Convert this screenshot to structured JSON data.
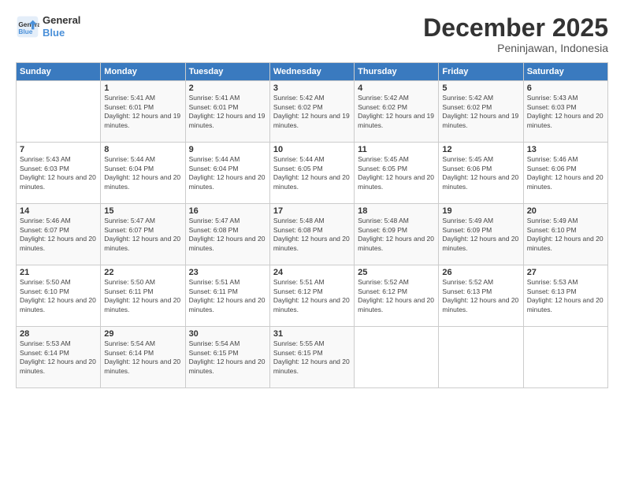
{
  "logo": {
    "line1": "General",
    "line2": "Blue"
  },
  "title": "December 2025",
  "location": "Peninjawan, Indonesia",
  "header_days": [
    "Sunday",
    "Monday",
    "Tuesday",
    "Wednesday",
    "Thursday",
    "Friday",
    "Saturday"
  ],
  "weeks": [
    [
      {
        "day": "",
        "sunrise": "",
        "sunset": "",
        "daylight": ""
      },
      {
        "day": "1",
        "sunrise": "Sunrise: 5:41 AM",
        "sunset": "Sunset: 6:01 PM",
        "daylight": "Daylight: 12 hours and 19 minutes."
      },
      {
        "day": "2",
        "sunrise": "Sunrise: 5:41 AM",
        "sunset": "Sunset: 6:01 PM",
        "daylight": "Daylight: 12 hours and 19 minutes."
      },
      {
        "day": "3",
        "sunrise": "Sunrise: 5:42 AM",
        "sunset": "Sunset: 6:02 PM",
        "daylight": "Daylight: 12 hours and 19 minutes."
      },
      {
        "day": "4",
        "sunrise": "Sunrise: 5:42 AM",
        "sunset": "Sunset: 6:02 PM",
        "daylight": "Daylight: 12 hours and 19 minutes."
      },
      {
        "day": "5",
        "sunrise": "Sunrise: 5:42 AM",
        "sunset": "Sunset: 6:02 PM",
        "daylight": "Daylight: 12 hours and 19 minutes."
      },
      {
        "day": "6",
        "sunrise": "Sunrise: 5:43 AM",
        "sunset": "Sunset: 6:03 PM",
        "daylight": "Daylight: 12 hours and 20 minutes."
      }
    ],
    [
      {
        "day": "7",
        "sunrise": "Sunrise: 5:43 AM",
        "sunset": "Sunset: 6:03 PM",
        "daylight": "Daylight: 12 hours and 20 minutes."
      },
      {
        "day": "8",
        "sunrise": "Sunrise: 5:44 AM",
        "sunset": "Sunset: 6:04 PM",
        "daylight": "Daylight: 12 hours and 20 minutes."
      },
      {
        "day": "9",
        "sunrise": "Sunrise: 5:44 AM",
        "sunset": "Sunset: 6:04 PM",
        "daylight": "Daylight: 12 hours and 20 minutes."
      },
      {
        "day": "10",
        "sunrise": "Sunrise: 5:44 AM",
        "sunset": "Sunset: 6:05 PM",
        "daylight": "Daylight: 12 hours and 20 minutes."
      },
      {
        "day": "11",
        "sunrise": "Sunrise: 5:45 AM",
        "sunset": "Sunset: 6:05 PM",
        "daylight": "Daylight: 12 hours and 20 minutes."
      },
      {
        "day": "12",
        "sunrise": "Sunrise: 5:45 AM",
        "sunset": "Sunset: 6:06 PM",
        "daylight": "Daylight: 12 hours and 20 minutes."
      },
      {
        "day": "13",
        "sunrise": "Sunrise: 5:46 AM",
        "sunset": "Sunset: 6:06 PM",
        "daylight": "Daylight: 12 hours and 20 minutes."
      }
    ],
    [
      {
        "day": "14",
        "sunrise": "Sunrise: 5:46 AM",
        "sunset": "Sunset: 6:07 PM",
        "daylight": "Daylight: 12 hours and 20 minutes."
      },
      {
        "day": "15",
        "sunrise": "Sunrise: 5:47 AM",
        "sunset": "Sunset: 6:07 PM",
        "daylight": "Daylight: 12 hours and 20 minutes."
      },
      {
        "day": "16",
        "sunrise": "Sunrise: 5:47 AM",
        "sunset": "Sunset: 6:08 PM",
        "daylight": "Daylight: 12 hours and 20 minutes."
      },
      {
        "day": "17",
        "sunrise": "Sunrise: 5:48 AM",
        "sunset": "Sunset: 6:08 PM",
        "daylight": "Daylight: 12 hours and 20 minutes."
      },
      {
        "day": "18",
        "sunrise": "Sunrise: 5:48 AM",
        "sunset": "Sunset: 6:09 PM",
        "daylight": "Daylight: 12 hours and 20 minutes."
      },
      {
        "day": "19",
        "sunrise": "Sunrise: 5:49 AM",
        "sunset": "Sunset: 6:09 PM",
        "daylight": "Daylight: 12 hours and 20 minutes."
      },
      {
        "day": "20",
        "sunrise": "Sunrise: 5:49 AM",
        "sunset": "Sunset: 6:10 PM",
        "daylight": "Daylight: 12 hours and 20 minutes."
      }
    ],
    [
      {
        "day": "21",
        "sunrise": "Sunrise: 5:50 AM",
        "sunset": "Sunset: 6:10 PM",
        "daylight": "Daylight: 12 hours and 20 minutes."
      },
      {
        "day": "22",
        "sunrise": "Sunrise: 5:50 AM",
        "sunset": "Sunset: 6:11 PM",
        "daylight": "Daylight: 12 hours and 20 minutes."
      },
      {
        "day": "23",
        "sunrise": "Sunrise: 5:51 AM",
        "sunset": "Sunset: 6:11 PM",
        "daylight": "Daylight: 12 hours and 20 minutes."
      },
      {
        "day": "24",
        "sunrise": "Sunrise: 5:51 AM",
        "sunset": "Sunset: 6:12 PM",
        "daylight": "Daylight: 12 hours and 20 minutes."
      },
      {
        "day": "25",
        "sunrise": "Sunrise: 5:52 AM",
        "sunset": "Sunset: 6:12 PM",
        "daylight": "Daylight: 12 hours and 20 minutes."
      },
      {
        "day": "26",
        "sunrise": "Sunrise: 5:52 AM",
        "sunset": "Sunset: 6:13 PM",
        "daylight": "Daylight: 12 hours and 20 minutes."
      },
      {
        "day": "27",
        "sunrise": "Sunrise: 5:53 AM",
        "sunset": "Sunset: 6:13 PM",
        "daylight": "Daylight: 12 hours and 20 minutes."
      }
    ],
    [
      {
        "day": "28",
        "sunrise": "Sunrise: 5:53 AM",
        "sunset": "Sunset: 6:14 PM",
        "daylight": "Daylight: 12 hours and 20 minutes."
      },
      {
        "day": "29",
        "sunrise": "Sunrise: 5:54 AM",
        "sunset": "Sunset: 6:14 PM",
        "daylight": "Daylight: 12 hours and 20 minutes."
      },
      {
        "day": "30",
        "sunrise": "Sunrise: 5:54 AM",
        "sunset": "Sunset: 6:15 PM",
        "daylight": "Daylight: 12 hours and 20 minutes."
      },
      {
        "day": "31",
        "sunrise": "Sunrise: 5:55 AM",
        "sunset": "Sunset: 6:15 PM",
        "daylight": "Daylight: 12 hours and 20 minutes."
      },
      {
        "day": "",
        "sunrise": "",
        "sunset": "",
        "daylight": ""
      },
      {
        "day": "",
        "sunrise": "",
        "sunset": "",
        "daylight": ""
      },
      {
        "day": "",
        "sunrise": "",
        "sunset": "",
        "daylight": ""
      }
    ]
  ]
}
